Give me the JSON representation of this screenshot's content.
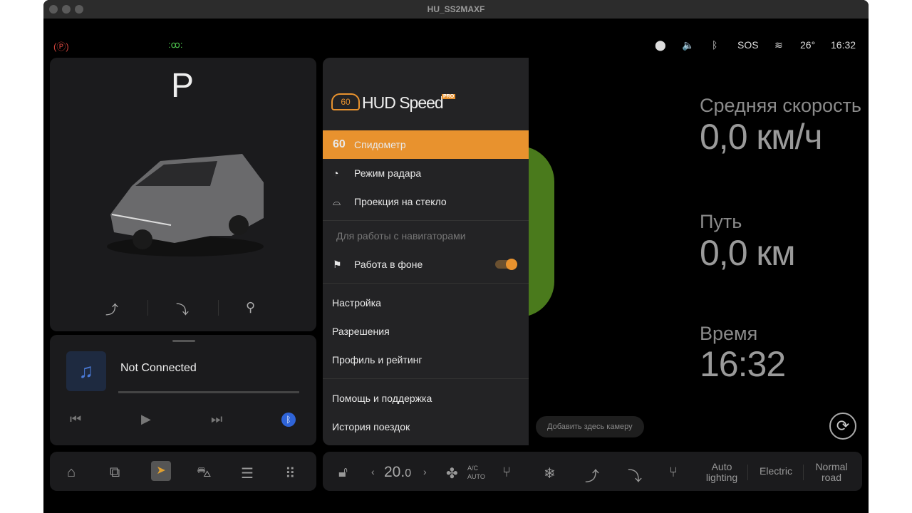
{
  "window": {
    "title": "HU_SS2MAXF"
  },
  "statusbar": {
    "sos": "SOS",
    "temperature": "26°",
    "time": "16:32"
  },
  "vehicle": {
    "gear": "P"
  },
  "media": {
    "status": "Not Connected",
    "progress": 0
  },
  "hud": {
    "logo_text": "HUD Speed",
    "logo_badge": "PRO",
    "logo_number": "60",
    "menu": [
      {
        "icon_text": "60",
        "label": "Спидометр",
        "active": true
      },
      {
        "label": "Режим радара"
      },
      {
        "label": "Проекция на стекло"
      }
    ],
    "section_header": "Для работы с навигаторами",
    "background_mode": {
      "label": "Работа в фоне",
      "enabled": true
    },
    "settings": [
      "Настройка",
      "Разрешения",
      "Профиль и рейтинг"
    ],
    "support": [
      "Помощь и поддержка",
      "История поездок"
    ],
    "accent": "#e8922e"
  },
  "stats": {
    "avg_speed_label": "Средняя скорость",
    "avg_speed_value": "0,0 км/ч",
    "distance_label": "Путь",
    "distance_value": "0,0 км",
    "time_label": "Время",
    "time_value": "16:32"
  },
  "camera_button": "Добавить здесь камеру",
  "climate": {
    "temp_main": "20.",
    "temp_dec": "0",
    "ac_line1": "A/C",
    "ac_line2": "AUTO",
    "auto_lighting": "Auto lighting",
    "electric": "Electric",
    "road": "Normal road"
  }
}
